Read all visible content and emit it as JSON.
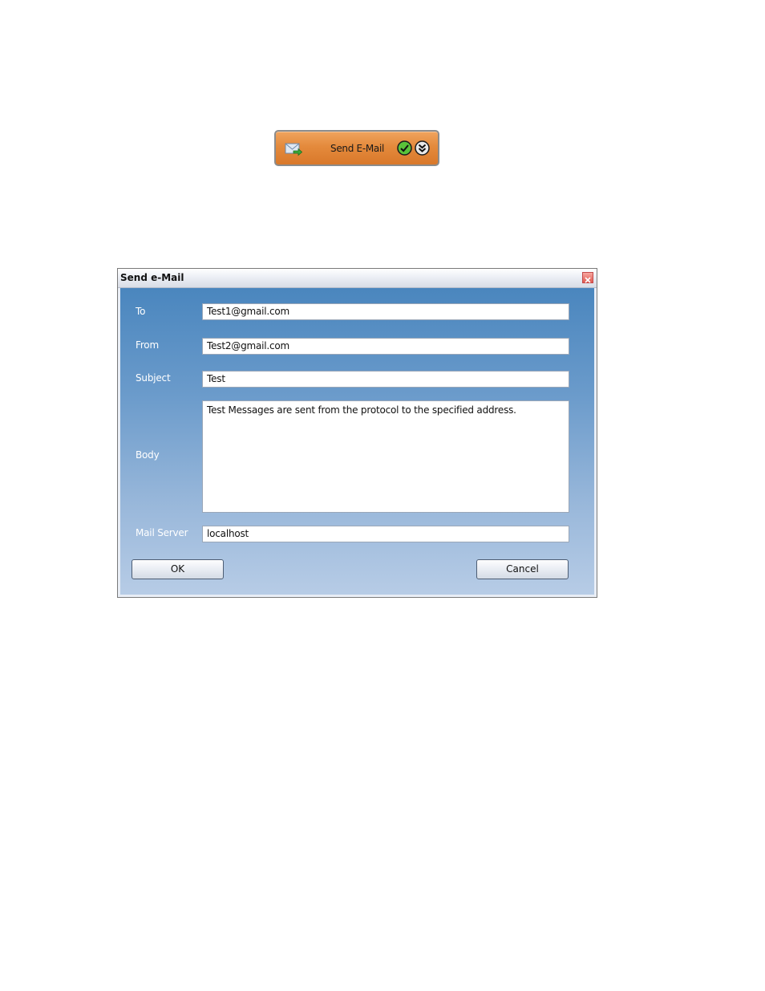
{
  "block": {
    "label": "Send E-Mail",
    "icon": "envelope-arrow-icon",
    "status_icon": "green-check-icon",
    "expand_icon": "double-chevron-down-icon",
    "color": "#e48a3c"
  },
  "dialog": {
    "title": "Send e-Mail",
    "fields": {
      "to": {
        "label": "To",
        "value": "Test1@gmail.com"
      },
      "from": {
        "label": "From",
        "value": "Test2@gmail.com"
      },
      "subject": {
        "label": "Subject",
        "value": "Test"
      },
      "body": {
        "label": "Body",
        "value": "Test Messages are sent from the protocol to the specified address."
      },
      "mail_server": {
        "label": "Mail Server",
        "value": "localhost"
      }
    },
    "buttons": {
      "ok": "OK",
      "cancel": "Cancel"
    }
  }
}
